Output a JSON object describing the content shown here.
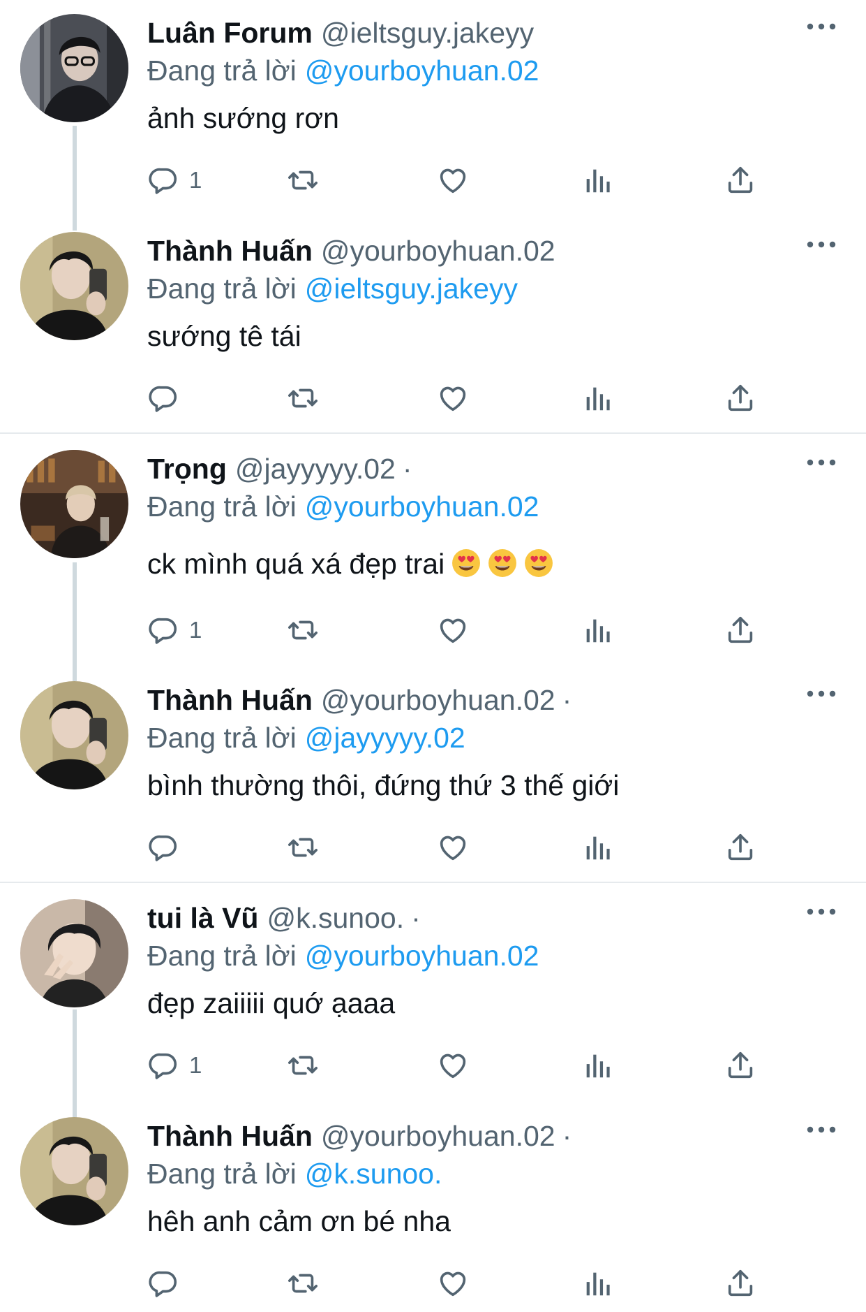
{
  "tweets": [
    {
      "name": "Luân Forum",
      "handle": "@ieltsguy.jakeyy",
      "dot": "",
      "reply_prefix": "Đang trả lời",
      "reply_to": "@yourboyhuan.02",
      "text": "ảnh sướng rơn",
      "reply_count": "1",
      "avatar": "avatar-1"
    },
    {
      "name": "Thành Huấn",
      "handle": "@yourboyhuan.02",
      "dot": "",
      "reply_prefix": "Đang trả lời",
      "reply_to": "@ieltsguy.jakeyy",
      "text": "sướng tê tái",
      "reply_count": "",
      "avatar": "avatar-huan"
    },
    {
      "name": "Trọng",
      "handle": "@jayyyyy.02",
      "dot": "·",
      "reply_prefix": "Đang trả lời",
      "reply_to": "@yourboyhuan.02",
      "text": "ck mình quá xá đẹp trai",
      "reply_count": "1",
      "avatar": "avatar-trong"
    },
    {
      "name": "Thành Huấn",
      "handle": "@yourboyhuan.02",
      "dot": "·",
      "reply_prefix": "Đang trả lời",
      "reply_to": "@jayyyyy.02",
      "text": "bình thường thôi, đứng thứ 3 thế giới",
      "reply_count": "",
      "avatar": "avatar-huan"
    },
    {
      "name": "tui là Vũ",
      "handle": "@k.sunoo.",
      "dot": "·",
      "reply_prefix": "Đang trả lời",
      "reply_to": "@yourboyhuan.02",
      "text": "đẹp zaiiiii quớ ạaaa",
      "reply_count": "1",
      "avatar": "avatar-vu"
    },
    {
      "name": "Thành Huấn",
      "handle": "@yourboyhuan.02",
      "dot": "·",
      "reply_prefix": "Đang trả lời",
      "reply_to": "@k.sunoo.",
      "text": "hêh anh cảm ơn bé nha",
      "reply_count": "",
      "avatar": "avatar-huan"
    }
  ],
  "icons": {
    "reply": "reply-icon",
    "retweet": "retweet-icon",
    "like": "heart-icon",
    "views": "analytics-icon",
    "share": "share-icon",
    "more": "more-icon",
    "emoji": "heart-eyes-emoji"
  },
  "colors": {
    "link": "#1d9bf0",
    "secondary": "#536471",
    "text": "#0f1419",
    "divider": "#e6eaed"
  }
}
